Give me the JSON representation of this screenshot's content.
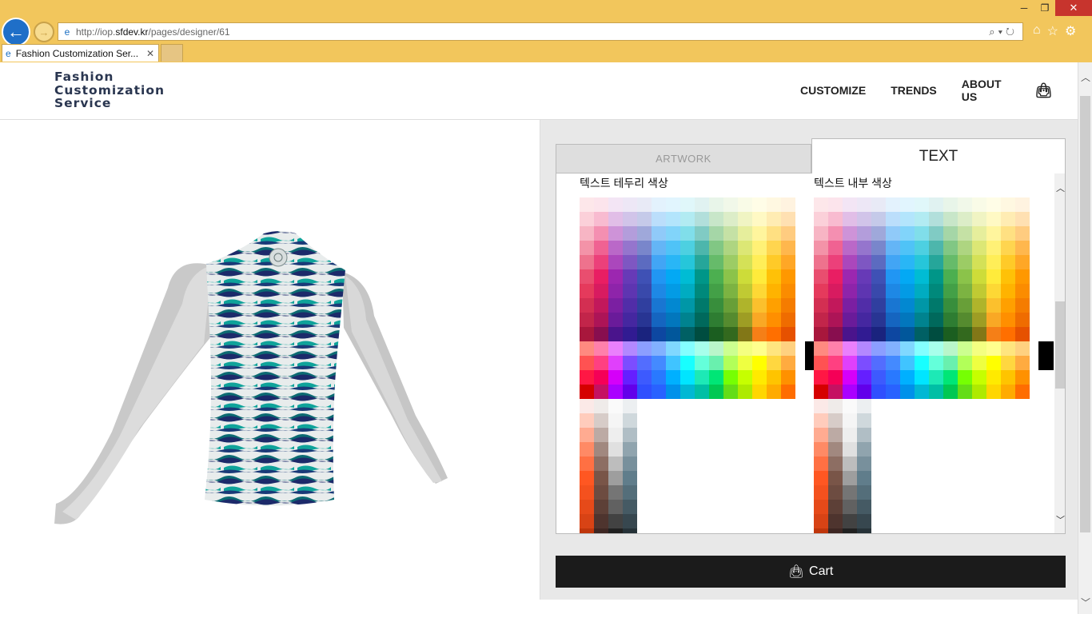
{
  "browser": {
    "url_prefix": "http://iop.",
    "url_domain": "sfdev.kr",
    "url_suffix": "/pages/designer/61",
    "tab_title": "Fashion Customization Ser...",
    "tab_close": "✕",
    "address_tools": "⌕▾↻",
    "window_minimize": "─",
    "window_maximize": "❐",
    "window_close": "✕"
  },
  "site": {
    "logo_line1": "Fashion",
    "logo_line2": "Customization",
    "logo_line3": "Service",
    "nav": {
      "customize": "CUSTOMIZE",
      "trends": "TRENDS",
      "about": "ABOUT US"
    }
  },
  "panel": {
    "tab_artwork": "ARTWORK",
    "tab_text": "TEXT",
    "outline_label": "텍스트 테두리 색상",
    "fill_label": "텍스트 내부 색상",
    "cart_label": "Cart"
  },
  "palette": {
    "hues": [
      [
        "#fde7ea",
        "#fbd0d9",
        "#f7b5c4",
        "#f393a8",
        "#ee728d",
        "#e94e6f",
        "#e53a5c",
        "#d32f52",
        "#c2254a",
        "#a8173c"
      ],
      [
        "#fce4ec",
        "#f8bbd0",
        "#f48fb1",
        "#f06292",
        "#ec407a",
        "#e91e63",
        "#d81b60",
        "#c2185b",
        "#ad1457",
        "#880e4f"
      ],
      [
        "#f3e5f5",
        "#e1bee7",
        "#ce93d8",
        "#ba68c8",
        "#ab47bc",
        "#9c27b0",
        "#8e24aa",
        "#7b1fa2",
        "#6a1b9a",
        "#4a148c"
      ],
      [
        "#ede7f6",
        "#d1c4e9",
        "#b39ddb",
        "#9575cd",
        "#7e57c2",
        "#673ab7",
        "#5e35b1",
        "#512da8",
        "#4527a0",
        "#311b92"
      ],
      [
        "#e8eaf6",
        "#c5cae9",
        "#9fa8da",
        "#7986cb",
        "#5c6bc0",
        "#3f51b5",
        "#3949ab",
        "#303f9f",
        "#283593",
        "#1a237e"
      ],
      [
        "#e3f2fd",
        "#bbdefb",
        "#90caf9",
        "#64b5f6",
        "#42a5f5",
        "#2196f3",
        "#1e88e5",
        "#1976d2",
        "#1565c0",
        "#0d47a1"
      ],
      [
        "#e1f5fe",
        "#b3e5fc",
        "#81d4fa",
        "#4fc3f7",
        "#29b6f6",
        "#03a9f4",
        "#039be5",
        "#0288d1",
        "#0277bd",
        "#01579b"
      ],
      [
        "#e0f7fa",
        "#b2ebf2",
        "#80deea",
        "#4dd0e1",
        "#26c6da",
        "#00bcd4",
        "#00acc1",
        "#0097a7",
        "#00838f",
        "#006064"
      ],
      [
        "#e0f2f1",
        "#b2dfdb",
        "#80cbc4",
        "#4db6ac",
        "#26a69a",
        "#009688",
        "#00897b",
        "#00796b",
        "#00695c",
        "#004d40"
      ],
      [
        "#e8f5e9",
        "#c8e6c9",
        "#a5d6a7",
        "#81c784",
        "#66bb6a",
        "#4caf50",
        "#43a047",
        "#388e3c",
        "#2e7d32",
        "#1b5e20"
      ],
      [
        "#f1f8e9",
        "#dcedc8",
        "#c5e1a5",
        "#aed581",
        "#9ccc65",
        "#8bc34a",
        "#7cb342",
        "#689f38",
        "#558b2f",
        "#33691e"
      ],
      [
        "#f9fbe7",
        "#f0f4c3",
        "#e6ee9c",
        "#dce775",
        "#d4e157",
        "#cddc39",
        "#c0ca33",
        "#afb42b",
        "#9e9d24",
        "#827717"
      ],
      [
        "#fffde7",
        "#fff9c4",
        "#fff59d",
        "#fff176",
        "#ffee58",
        "#ffeb3b",
        "#fdd835",
        "#fbc02d",
        "#f9a825",
        "#f57f17"
      ],
      [
        "#fff8e1",
        "#ffecb3",
        "#ffe082",
        "#ffd54f",
        "#ffca28",
        "#ffc107",
        "#ffb300",
        "#ffa000",
        "#ff8f00",
        "#ff6f00"
      ],
      [
        "#fff3e0",
        "#ffe0b2",
        "#ffcc80",
        "#ffb74d",
        "#ffa726",
        "#ff9800",
        "#fb8c00",
        "#f57c00",
        "#ef6c00",
        "#e65100"
      ]
    ],
    "accents": [
      [
        "#ff8a80",
        "#ff5252",
        "#ff1744",
        "#d50000"
      ],
      [
        "#ff80ab",
        "#ff4081",
        "#f50057",
        "#c51162"
      ],
      [
        "#ea80fc",
        "#e040fb",
        "#d500f9",
        "#aa00ff"
      ],
      [
        "#b388ff",
        "#7c4dff",
        "#651fff",
        "#6200ea"
      ],
      [
        "#8c9eff",
        "#536dfe",
        "#3d5afe",
        "#304ffe"
      ],
      [
        "#82b1ff",
        "#448aff",
        "#2979ff",
        "#2962ff"
      ],
      [
        "#80d8ff",
        "#40c4ff",
        "#00b0ff",
        "#0091ea"
      ],
      [
        "#84ffff",
        "#18ffff",
        "#00e5ff",
        "#00b8d4"
      ],
      [
        "#a7ffeb",
        "#64ffda",
        "#1de9b6",
        "#00bfa5"
      ],
      [
        "#b9f6ca",
        "#69f0ae",
        "#00e676",
        "#00c853"
      ],
      [
        "#ccff90",
        "#b2ff59",
        "#76ff03",
        "#64dd17"
      ],
      [
        "#f4ff81",
        "#eeff41",
        "#c6ff00",
        "#aeea00"
      ],
      [
        "#ffff8d",
        "#ffff00",
        "#ffea00",
        "#ffd600"
      ],
      [
        "#ffe57f",
        "#ffd740",
        "#ffc400",
        "#ffab00"
      ],
      [
        "#ffd180",
        "#ffab40",
        "#ff9100",
        "#ff6d00"
      ]
    ],
    "neutrals": [
      [
        "#fbe9e7",
        "#ffccbc",
        "#ffab91",
        "#ff8a65",
        "#ff7043",
        "#ff5722",
        "#f4511e",
        "#e64a19",
        "#d84315",
        "#bf360c"
      ],
      [
        "#efebe9",
        "#d7ccc8",
        "#bcaaa4",
        "#a1887f",
        "#8d6e63",
        "#795548",
        "#6d4c41",
        "#5d4037",
        "#4e342e",
        "#3e2723"
      ],
      [
        "#fafafa",
        "#f5f5f5",
        "#eeeeee",
        "#e0e0e0",
        "#bdbdbd",
        "#9e9e9e",
        "#757575",
        "#616161",
        "#424242",
        "#212121"
      ],
      [
        "#eceff1",
        "#cfd8dc",
        "#b0bec5",
        "#90a4ae",
        "#78909c",
        "#607d8b",
        "#546e7a",
        "#455a64",
        "#37474f",
        "#263238"
      ]
    ]
  }
}
